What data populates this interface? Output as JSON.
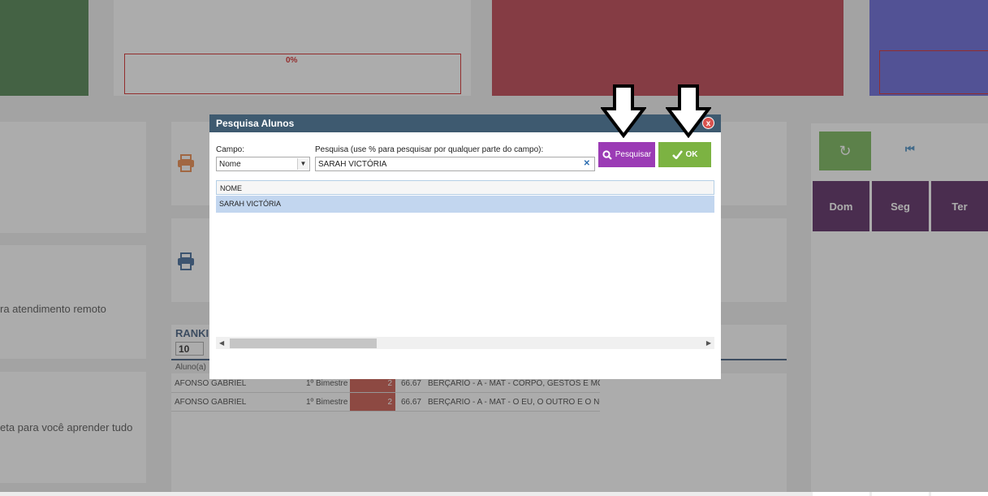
{
  "background": {
    "progress_label": "0%",
    "cards": {
      "remote_text": "ra atendimento remoto",
      "learn_text": "eta para você aprender tudo"
    },
    "ranking": {
      "title": "RANKIN",
      "count": "10",
      "column_header": "Aluno(a)",
      "rows": [
        {
          "name": "AFONSO GABRIEL",
          "period": "1º Bimestre",
          "score": "2",
          "pct": "66.67",
          "subject": "BERÇARIO - A - MAT - CORPO, GESTOS E MOVIMENTO"
        },
        {
          "name": "AFONSO GABRIEL",
          "period": "1º Bimestre",
          "score": "2",
          "pct": "66.67",
          "subject": "BERÇARIO - A - MAT - O EU, O OUTRO E O NÓS|TRAÇ"
        }
      ]
    },
    "calendar": {
      "days": [
        "Dom",
        "Seg",
        "Ter"
      ]
    }
  },
  "modal": {
    "title": "Pesquisa Alunos",
    "close_label": "x",
    "campo_label": "Campo:",
    "campo_value": "Nome",
    "search_label": "Pesquisa (use % para pesquisar por qualquer parte do campo):",
    "search_value": "SARAH VICTÓRIA",
    "search_button": "Pesquisar",
    "ok_button": "OK",
    "grid_header": "NOME",
    "results": [
      "SARAH VICTÓRIA"
    ]
  },
  "colors": {
    "title_bar": "#3e5a70",
    "search_button": "#9b3bb5",
    "ok_button": "#7cb342",
    "selected_row": "#c2d6ef",
    "close_button": "#d9534f"
  }
}
